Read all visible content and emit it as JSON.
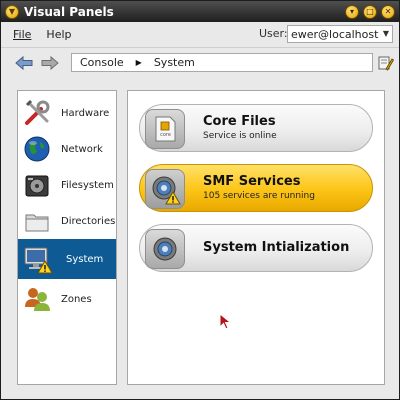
{
  "window": {
    "title": "Visual Panels"
  },
  "menu": {
    "file": "File",
    "help": "Help"
  },
  "user": {
    "label": "User:",
    "value": "ewer@localhost"
  },
  "breadcrumb": [
    "Console",
    "System"
  ],
  "sidebar": {
    "items": [
      {
        "label": "Hardware",
        "icon": "tools-icon"
      },
      {
        "label": "Network",
        "icon": "globe-icon"
      },
      {
        "label": "Filesystem",
        "icon": "drive-icon"
      },
      {
        "label": "Directories",
        "icon": "folder-icon"
      },
      {
        "label": "System",
        "icon": "monitor-warning-icon",
        "selected": true
      },
      {
        "label": "Zones",
        "icon": "users-icon"
      }
    ]
  },
  "cards": [
    {
      "title": "Core Files",
      "subtitle": "Service is online"
    },
    {
      "title": "SMF Services",
      "subtitle": "105 services are running",
      "active": true
    },
    {
      "title": "System Intialization",
      "subtitle": ""
    }
  ],
  "colors": {
    "selection": "#0d5a94",
    "active_card": "#fcc415",
    "titlebar": "#2b2b2b"
  }
}
